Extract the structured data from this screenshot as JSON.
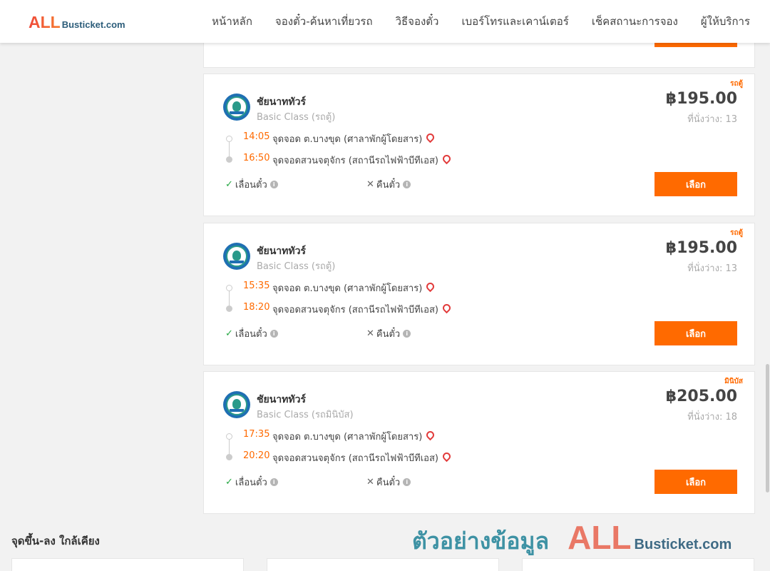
{
  "nav": {
    "logo_all": "ALL",
    "logo_rest": "Busticket.com",
    "items": [
      "หน้าหลัก",
      "จองตั๋ว-ค้นหาเที่ยวรถ",
      "วิธีจองตั๋ว",
      "เบอร์โทรและเคาน์เตอร์",
      "เช็คสถานะการจอง",
      "ผู้ให้บริการ"
    ]
  },
  "trips": [
    {
      "tag": "รถตู้",
      "operator": "ชัยนาททัวร์",
      "class": "Basic Class (รถตู้)",
      "price": "฿195.00",
      "seats": "ที่นั่งว่าง: 13",
      "depart_time": "14:05",
      "depart_stop": "จุดจอด ต.บางขุด (ศาลาพักผู้โดยสาร)",
      "arrive_time": "16:50",
      "arrive_stop": "จุดจอดสวนจตุจักร (สถานีรถไฟฟ้าบีทีเอส)",
      "reschedule": "เลื่อนตั๋ว",
      "refund": "คืนตั๋ว",
      "select": "เลือก"
    },
    {
      "tag": "รถตู้",
      "operator": "ชัยนาททัวร์",
      "class": "Basic Class (รถตู้)",
      "price": "฿195.00",
      "seats": "ที่นั่งว่าง: 13",
      "depart_time": "15:35",
      "depart_stop": "จุดจอด ต.บางขุด (ศาลาพักผู้โดยสาร)",
      "arrive_time": "18:20",
      "arrive_stop": "จุดจอดสวนจตุจักร (สถานีรถไฟฟ้าบีทีเอส)",
      "reschedule": "เลื่อนตั๋ว",
      "refund": "คืนตั๋ว",
      "select": "เลือก"
    },
    {
      "tag": "มินิบัส",
      "operator": "ชัยนาททัวร์",
      "class": "Basic Class (รถมินิบัส)",
      "price": "฿205.00",
      "seats": "ที่นั่งว่าง: 18",
      "depart_time": "17:35",
      "depart_stop": "จุดจอด ต.บางขุด (ศาลาพักผู้โดยสาร)",
      "arrive_time": "20:20",
      "arrive_stop": "จุดจอดสวนจตุจักร (สถานีรถไฟฟ้าบีทีเอส)",
      "reschedule": "เลื่อนตั๋ว",
      "refund": "คืนตั๋ว",
      "select": "เลือก"
    }
  ],
  "nearby": {
    "title": "จุดขึ้น-ลง ใกล้เคียง"
  },
  "watermark": {
    "text": "ตัวอย่างข้อมูล",
    "all": "ALL",
    "rest": "Busticket.com"
  },
  "colors": {
    "accent": "#ff6a00",
    "check": "#27a844",
    "pin": "#e23b3b"
  }
}
